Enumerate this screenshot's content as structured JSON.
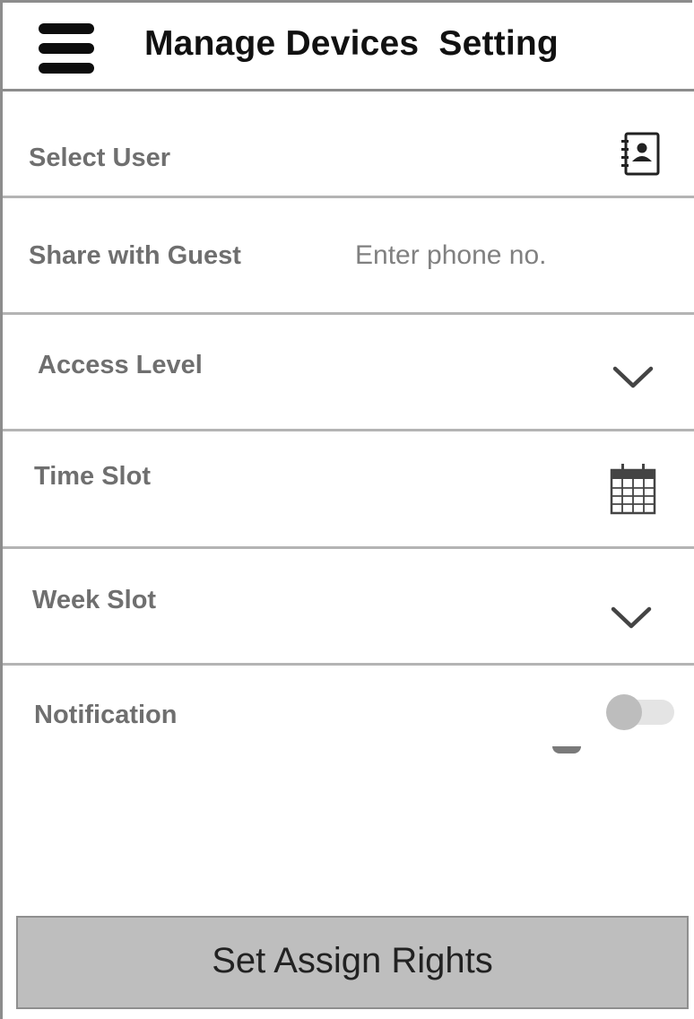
{
  "header": {
    "title": "Manage Devices  Setting",
    "menu_icon": "hamburger-menu-icon"
  },
  "form": {
    "select_user": {
      "label": "Select User",
      "icon": "contact-book-icon"
    },
    "share_with_guest": {
      "label": "Share with Guest",
      "placeholder": "Enter phone no.",
      "value": ""
    },
    "access_level": {
      "label": "Access Level",
      "icon": "chevron-down-icon"
    },
    "time_slot": {
      "label": "Time Slot",
      "icon": "calendar-icon"
    },
    "week_slot": {
      "label": "Week Slot",
      "icon": "chevron-down-icon"
    },
    "notification": {
      "label": "Notification",
      "enabled": false
    }
  },
  "actions": {
    "submit_label": "Set Assign Rights"
  },
  "colors": {
    "label_gray": "#6f6f6f",
    "divider": "#b4b4b4",
    "button_bg": "#bebebe",
    "toggle_knob_off": "#bdbdbd",
    "toggle_track_off": "#e4e4e4"
  }
}
